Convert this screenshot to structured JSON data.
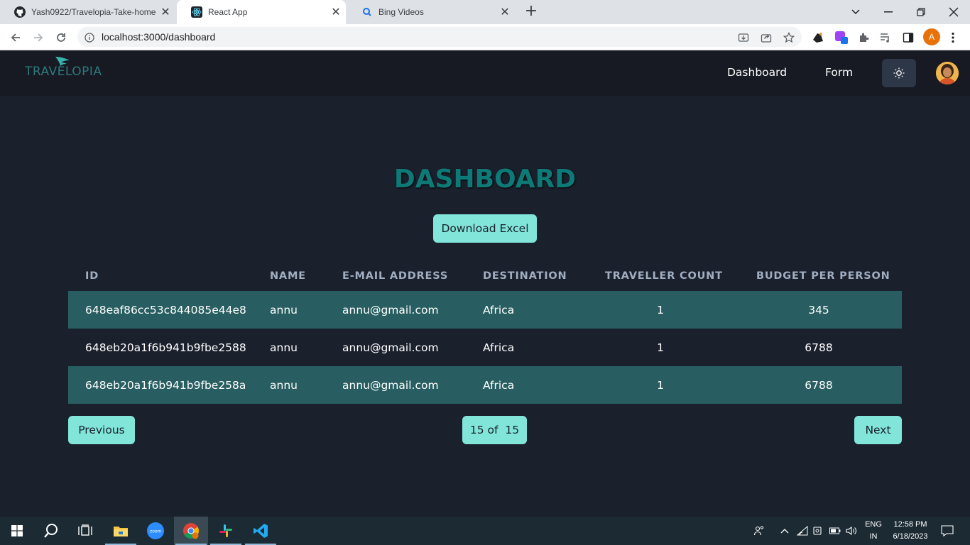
{
  "browser": {
    "tabs": [
      {
        "title": "Yash0922/Travelopia-Take-home-",
        "active": false,
        "icon": "github-icon"
      },
      {
        "title": "React App",
        "active": true,
        "icon": "react-icon"
      },
      {
        "title": "Bing Videos",
        "active": false,
        "icon": "bing-search-icon"
      }
    ],
    "new_tab": "+",
    "url": "localhost:3000/dashboard",
    "profile_initial": "A"
  },
  "navbar": {
    "logo_text": "TRAVELOPIA",
    "links": [
      "Dashboard",
      "Form"
    ],
    "theme_icon": "sun-icon",
    "colors": {
      "background": "#171923",
      "logo": "#2c7a7b"
    }
  },
  "main": {
    "title": "DASHBOARD",
    "download_label": "Download Excel",
    "table": {
      "columns": [
        "ID",
        "NAME",
        "E-MAIL ADDRESS",
        "DESTINATION",
        "TRAVELLER COUNT",
        "BUDGET PER PERSON"
      ],
      "rows": [
        {
          "id": "648eaf86cc53c844085e44e8",
          "name": "annu",
          "email": "annu@gmail.com",
          "destination": "Africa",
          "count": "1",
          "budget": "345"
        },
        {
          "id": "648eb20a1f6b941b9fbe2588",
          "name": "annu",
          "email": "annu@gmail.com",
          "destination": "Africa",
          "count": "1",
          "budget": "6788"
        },
        {
          "id": "648eb20a1f6b941b9fbe258a",
          "name": "annu",
          "email": "annu@gmail.com",
          "destination": "Africa",
          "count": "1",
          "budget": "6788"
        }
      ]
    },
    "pagination": {
      "previous_label": "Previous",
      "page_label": "15 of  15",
      "next_label": "Next"
    },
    "colors": {
      "background": "#1a202c",
      "accent": "#81e6d9",
      "title": "#0e7a78",
      "stripe": "#285e61"
    }
  },
  "taskbar": {
    "language": "ENG",
    "region": "IN",
    "time": "12:58 PM",
    "date": "6/18/2023",
    "apps": [
      "windows-start-icon",
      "search-icon",
      "task-view-icon",
      "file-explorer-icon",
      "zoom-icon",
      "chrome-icon",
      "slack-icon",
      "vscode-icon"
    ],
    "zoom_label": "zoom"
  }
}
